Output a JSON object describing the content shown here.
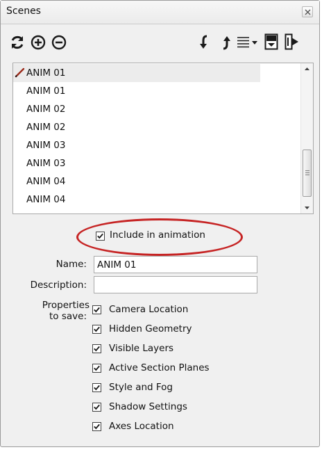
{
  "window": {
    "title": "Scenes"
  },
  "toolbar": {
    "icons": [
      "refresh-icon",
      "add-scene-icon",
      "remove-scene-icon",
      "move-scene-down-icon",
      "move-scene-up-icon",
      "view-options-icon",
      "show-details-icon",
      "expand-icon"
    ]
  },
  "scene_list": {
    "items": [
      {
        "label": "ANIM 01",
        "selected": true
      },
      {
        "label": "ANIM 01"
      },
      {
        "label": "ANIM 02"
      },
      {
        "label": "ANIM 02"
      },
      {
        "label": "ANIM 03"
      },
      {
        "label": "ANIM 03"
      },
      {
        "label": "ANIM 04"
      },
      {
        "label": "ANIM 04"
      }
    ]
  },
  "include_in_animation": {
    "label": "Include in animation",
    "checked": true
  },
  "name_field": {
    "label": "Name:",
    "value": "ANIM 01"
  },
  "description_field": {
    "label": "Description:",
    "value": ""
  },
  "properties": {
    "label_line1": "Properties",
    "label_line2": "to save:",
    "options": [
      {
        "label": "Camera Location",
        "checked": true
      },
      {
        "label": "Hidden Geometry",
        "checked": true
      },
      {
        "label": "Visible Layers",
        "checked": true
      },
      {
        "label": "Active Section Planes",
        "checked": true
      },
      {
        "label": "Style and Fog",
        "checked": true
      },
      {
        "label": "Shadow Settings",
        "checked": true
      },
      {
        "label": "Axes Location",
        "checked": true
      }
    ]
  },
  "colors": {
    "highlight": "#c62424",
    "panel": "#f0f0f0",
    "pencil": "#9b2a1a"
  }
}
